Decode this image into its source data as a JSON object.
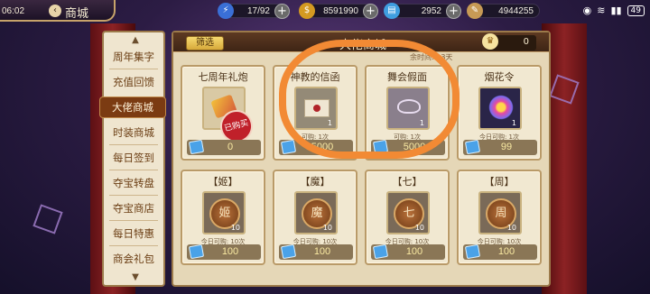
{
  "status_bar": {
    "time": "06:02",
    "battery": "49"
  },
  "header": {
    "title": "商城",
    "resources": [
      {
        "icon": "lightning-icon",
        "value": "17/92"
      },
      {
        "icon": "gold-coin-icon",
        "value": "8591990"
      },
      {
        "icon": "ticket-icon",
        "value": "2952"
      },
      {
        "icon": "feather-icon",
        "value": "4944255"
      }
    ]
  },
  "sidebar": {
    "items": [
      {
        "label": "周年集字"
      },
      {
        "label": "充值回馈"
      },
      {
        "label": "大佬商城",
        "active": true
      },
      {
        "label": "时装商城"
      },
      {
        "label": "每日签到"
      },
      {
        "label": "夺宝转盘"
      },
      {
        "label": "夺宝商店"
      },
      {
        "label": "每日特惠"
      },
      {
        "label": "商会礼包"
      }
    ]
  },
  "panel": {
    "filter_label": "筛选",
    "title": "大佬商城",
    "countdown": "余时间: 13天",
    "token_value": "0"
  },
  "cards": [
    {
      "name": "七周年礼炮",
      "qty": "",
      "limit": "可购: 1次",
      "price": "0",
      "sold_label": "已购买"
    },
    {
      "name": "神教的信函",
      "qty": "1",
      "limit": "可购: 1次",
      "price": "5000"
    },
    {
      "name": "舞会假面",
      "qty": "1",
      "limit": "可购: 1次",
      "price": "5000"
    },
    {
      "name": "烟花令",
      "qty": "1",
      "limit": "今日可购: 1次",
      "price": "99"
    },
    {
      "name": "【姬】",
      "coin": "姬",
      "qty": "10",
      "limit": "今日可购: 10次",
      "price": "100"
    },
    {
      "name": "【魔】",
      "coin": "魔",
      "qty": "10",
      "limit": "今日可购: 10次",
      "price": "100"
    },
    {
      "name": "【七】",
      "coin": "七",
      "qty": "10",
      "limit": "今日可购: 10次",
      "price": "100"
    },
    {
      "name": "【周】",
      "coin": "周",
      "qty": "10",
      "limit": "今日可购: 10次",
      "price": "100"
    }
  ],
  "colors": {
    "accent": "#7b3b12",
    "price_text": "#f9e9a2",
    "annotation": "#f28a34"
  }
}
